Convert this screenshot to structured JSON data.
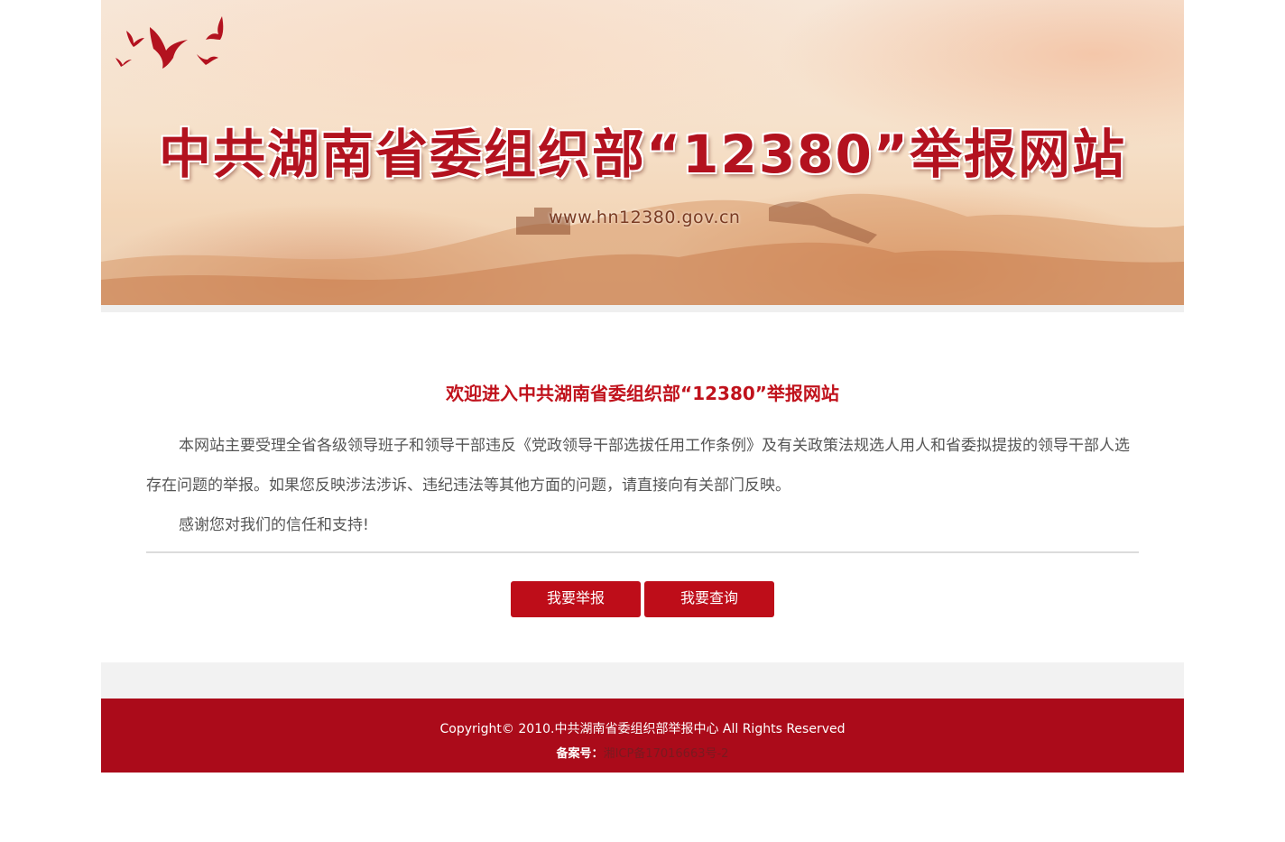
{
  "banner": {
    "title": "中共湖南省委组织部“12380”举报网站",
    "url": "www.hn12380.gov.cn"
  },
  "main": {
    "welcome": "欢迎进入中共湖南省委组织部“12380”举报网站",
    "intro": "本网站主要受理全省各级领导班子和领导干部违反《党政领导干部选拔任用工作条例》及有关政策法规选人用人和省委拟提拔的领导干部人选存在问题的举报。如果您反映涉法涉诉、违纪违法等其他方面的问题，请直接向有关部门反映。",
    "thanks": "感谢您对我们的信任和支持!",
    "report_button": "我要举报",
    "query_button": "我要查询"
  },
  "footer": {
    "copyright": "Copyright© 2010.中共湖南省委组织部举报中心 All Rights Reserved",
    "icp_label": "备案号：",
    "icp_number": "湘ICP备17016663号-2"
  },
  "colors": {
    "brand_red": "#ab0b1a",
    "button_red": "#be0d19",
    "title_red": "#c0121c"
  }
}
